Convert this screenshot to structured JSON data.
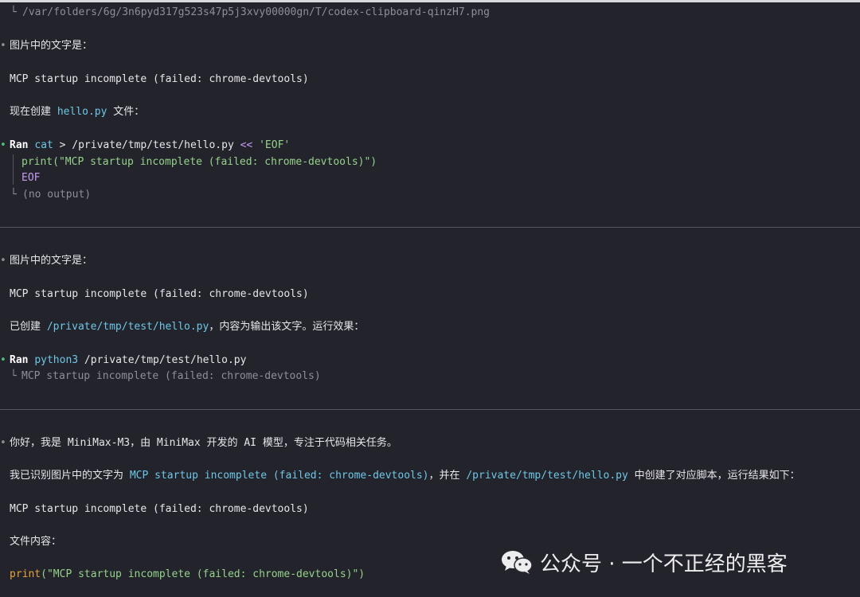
{
  "prev_tail": {
    "path": "/var/folders/6g/3n6pyd317g523s47p5j3xvy00000gn/T/codex-clipboard-qinzH7.png"
  },
  "block1": {
    "intro": "图片中的文字是：",
    "extracted": "MCP startup incomplete (failed: chrome-devtools)",
    "create_prefix": "现在创建 ",
    "create_file": "hello.py",
    "create_suffix": " 文件：",
    "cmd_ran": "Ran",
    "cmd_name": "cat",
    "cmd_redirect": " > /private/tmp/test/hello.py ",
    "cmd_heredoc": "<<",
    "cmd_eof_quoted": " 'EOF'",
    "heredoc_line1": "print(\"MCP startup incomplete (failed: chrome-devtools)\")",
    "heredoc_line2": "EOF",
    "output": "(no output)"
  },
  "block2": {
    "intro": "图片中的文字是：",
    "extracted": "MCP startup incomplete (failed: chrome-devtools)",
    "created_prefix": "已创建 ",
    "created_path": "/private/tmp/test/hello.py",
    "created_suffix": "，内容为输出该文字。运行效果：",
    "cmd_ran": "Ran",
    "cmd_name": "python3",
    "cmd_args": " /private/tmp/test/hello.py",
    "output": "MCP startup incomplete (failed: chrome-devtools)"
  },
  "block3": {
    "intro": "你好，我是 MiniMax-M3，由 MiniMax 开发的 AI 模型，专注于代码相关任务。",
    "summary_prefix": "我已识别图片中的文字为 ",
    "summary_text": "MCP startup incomplete (failed: chrome-devtools)",
    "summary_middle": "，并在 ",
    "summary_path": "/private/tmp/test/hello.py",
    "summary_suffix": " 中创建了对应脚本，运行结果如下：",
    "result": "MCP startup incomplete (failed: chrome-devtools)",
    "file_content_label": "文件内容：",
    "code_fn": "print",
    "code_args": "(\"MCP startup incomplete (failed: chrome-devtools)\")"
  },
  "watermark": {
    "icon": "wechat-icon",
    "text": "公众号 · 一个不正经的黑客"
  },
  "colors": {
    "background": "#23232c",
    "accent_cyan": "#6ec7e6",
    "accent_purple": "#c79bf2",
    "accent_green": "#95d28a",
    "accent_orange": "#e9a23b",
    "bullet_green": "#52c27a"
  }
}
